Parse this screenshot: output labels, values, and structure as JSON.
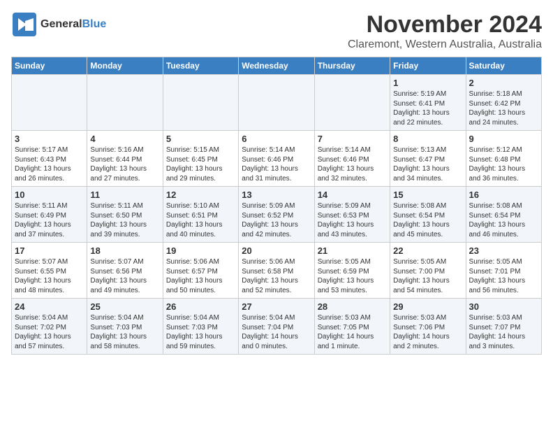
{
  "header": {
    "logo_general": "General",
    "logo_blue": "Blue",
    "month": "November 2024",
    "location": "Claremont, Western Australia, Australia"
  },
  "days_of_week": [
    "Sunday",
    "Monday",
    "Tuesday",
    "Wednesday",
    "Thursday",
    "Friday",
    "Saturday"
  ],
  "weeks": [
    [
      {
        "day": "",
        "info": ""
      },
      {
        "day": "",
        "info": ""
      },
      {
        "day": "",
        "info": ""
      },
      {
        "day": "",
        "info": ""
      },
      {
        "day": "",
        "info": ""
      },
      {
        "day": "1",
        "info": "Sunrise: 5:19 AM\nSunset: 6:41 PM\nDaylight: 13 hours\nand 22 minutes."
      },
      {
        "day": "2",
        "info": "Sunrise: 5:18 AM\nSunset: 6:42 PM\nDaylight: 13 hours\nand 24 minutes."
      }
    ],
    [
      {
        "day": "3",
        "info": "Sunrise: 5:17 AM\nSunset: 6:43 PM\nDaylight: 13 hours\nand 26 minutes."
      },
      {
        "day": "4",
        "info": "Sunrise: 5:16 AM\nSunset: 6:44 PM\nDaylight: 13 hours\nand 27 minutes."
      },
      {
        "day": "5",
        "info": "Sunrise: 5:15 AM\nSunset: 6:45 PM\nDaylight: 13 hours\nand 29 minutes."
      },
      {
        "day": "6",
        "info": "Sunrise: 5:14 AM\nSunset: 6:46 PM\nDaylight: 13 hours\nand 31 minutes."
      },
      {
        "day": "7",
        "info": "Sunrise: 5:14 AM\nSunset: 6:46 PM\nDaylight: 13 hours\nand 32 minutes."
      },
      {
        "day": "8",
        "info": "Sunrise: 5:13 AM\nSunset: 6:47 PM\nDaylight: 13 hours\nand 34 minutes."
      },
      {
        "day": "9",
        "info": "Sunrise: 5:12 AM\nSunset: 6:48 PM\nDaylight: 13 hours\nand 36 minutes."
      }
    ],
    [
      {
        "day": "10",
        "info": "Sunrise: 5:11 AM\nSunset: 6:49 PM\nDaylight: 13 hours\nand 37 minutes."
      },
      {
        "day": "11",
        "info": "Sunrise: 5:11 AM\nSunset: 6:50 PM\nDaylight: 13 hours\nand 39 minutes."
      },
      {
        "day": "12",
        "info": "Sunrise: 5:10 AM\nSunset: 6:51 PM\nDaylight: 13 hours\nand 40 minutes."
      },
      {
        "day": "13",
        "info": "Sunrise: 5:09 AM\nSunset: 6:52 PM\nDaylight: 13 hours\nand 42 minutes."
      },
      {
        "day": "14",
        "info": "Sunrise: 5:09 AM\nSunset: 6:53 PM\nDaylight: 13 hours\nand 43 minutes."
      },
      {
        "day": "15",
        "info": "Sunrise: 5:08 AM\nSunset: 6:54 PM\nDaylight: 13 hours\nand 45 minutes."
      },
      {
        "day": "16",
        "info": "Sunrise: 5:08 AM\nSunset: 6:54 PM\nDaylight: 13 hours\nand 46 minutes."
      }
    ],
    [
      {
        "day": "17",
        "info": "Sunrise: 5:07 AM\nSunset: 6:55 PM\nDaylight: 13 hours\nand 48 minutes."
      },
      {
        "day": "18",
        "info": "Sunrise: 5:07 AM\nSunset: 6:56 PM\nDaylight: 13 hours\nand 49 minutes."
      },
      {
        "day": "19",
        "info": "Sunrise: 5:06 AM\nSunset: 6:57 PM\nDaylight: 13 hours\nand 50 minutes."
      },
      {
        "day": "20",
        "info": "Sunrise: 5:06 AM\nSunset: 6:58 PM\nDaylight: 13 hours\nand 52 minutes."
      },
      {
        "day": "21",
        "info": "Sunrise: 5:05 AM\nSunset: 6:59 PM\nDaylight: 13 hours\nand 53 minutes."
      },
      {
        "day": "22",
        "info": "Sunrise: 5:05 AM\nSunset: 7:00 PM\nDaylight: 13 hours\nand 54 minutes."
      },
      {
        "day": "23",
        "info": "Sunrise: 5:05 AM\nSunset: 7:01 PM\nDaylight: 13 hours\nand 56 minutes."
      }
    ],
    [
      {
        "day": "24",
        "info": "Sunrise: 5:04 AM\nSunset: 7:02 PM\nDaylight: 13 hours\nand 57 minutes."
      },
      {
        "day": "25",
        "info": "Sunrise: 5:04 AM\nSunset: 7:03 PM\nDaylight: 13 hours\nand 58 minutes."
      },
      {
        "day": "26",
        "info": "Sunrise: 5:04 AM\nSunset: 7:03 PM\nDaylight: 13 hours\nand 59 minutes."
      },
      {
        "day": "27",
        "info": "Sunrise: 5:04 AM\nSunset: 7:04 PM\nDaylight: 14 hours\nand 0 minutes."
      },
      {
        "day": "28",
        "info": "Sunrise: 5:03 AM\nSunset: 7:05 PM\nDaylight: 14 hours\nand 1 minute."
      },
      {
        "day": "29",
        "info": "Sunrise: 5:03 AM\nSunset: 7:06 PM\nDaylight: 14 hours\nand 2 minutes."
      },
      {
        "day": "30",
        "info": "Sunrise: 5:03 AM\nSunset: 7:07 PM\nDaylight: 14 hours\nand 3 minutes."
      }
    ]
  ]
}
